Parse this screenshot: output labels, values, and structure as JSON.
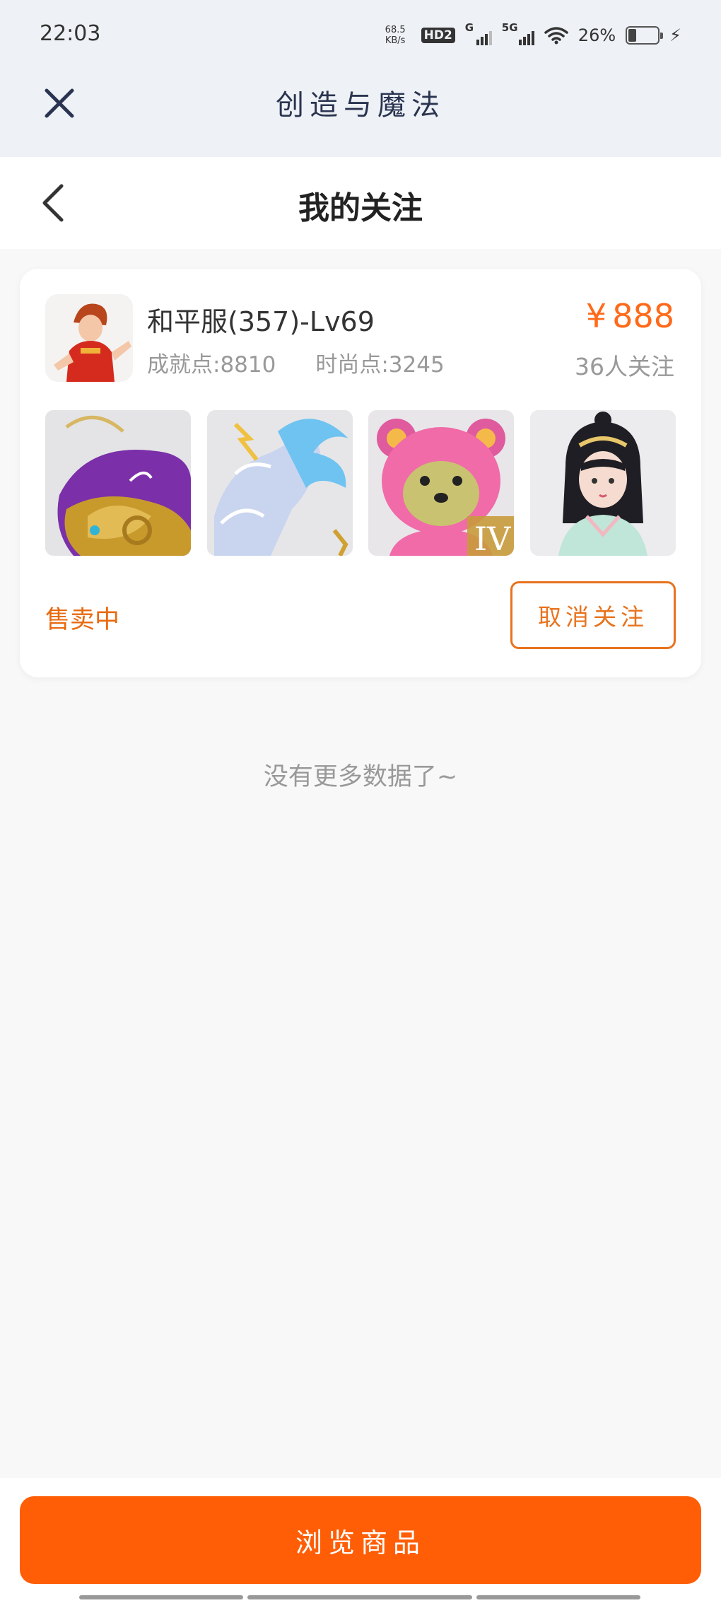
{
  "status_bar": {
    "time": "22:03",
    "net_speed_value": "68.5",
    "net_speed_unit": "KB/s",
    "hd_badge": "HD2",
    "sim1_label": "G",
    "sim2_label": "5G",
    "battery_percent": "26%"
  },
  "app_header": {
    "title": "创造与魔法",
    "close_icon": "close-icon"
  },
  "page_header": {
    "title": "我的关注",
    "back_icon": "chevron-left-icon"
  },
  "card": {
    "server_name": "和平服(357)-Lv69",
    "achievement": "成就点:8810",
    "fashion": "时尚点:3245",
    "price_symbol": "¥",
    "price_value": "888",
    "followers": "36人关注",
    "status": "售卖中",
    "unfollow_label": "取消关注",
    "thumbnails": [
      "fish-mount",
      "ice-horse-mount",
      "pink-bear-pet",
      "hanfu-character"
    ]
  },
  "no_more_text": "没有更多数据了~",
  "bottom": {
    "browse_label": "浏览商品"
  },
  "colors": {
    "accent_orange": "#ff5e06",
    "price_orange": "#ff6a1a",
    "header_bg": "#eef1f5",
    "page_bg": "#f8f8f9"
  }
}
